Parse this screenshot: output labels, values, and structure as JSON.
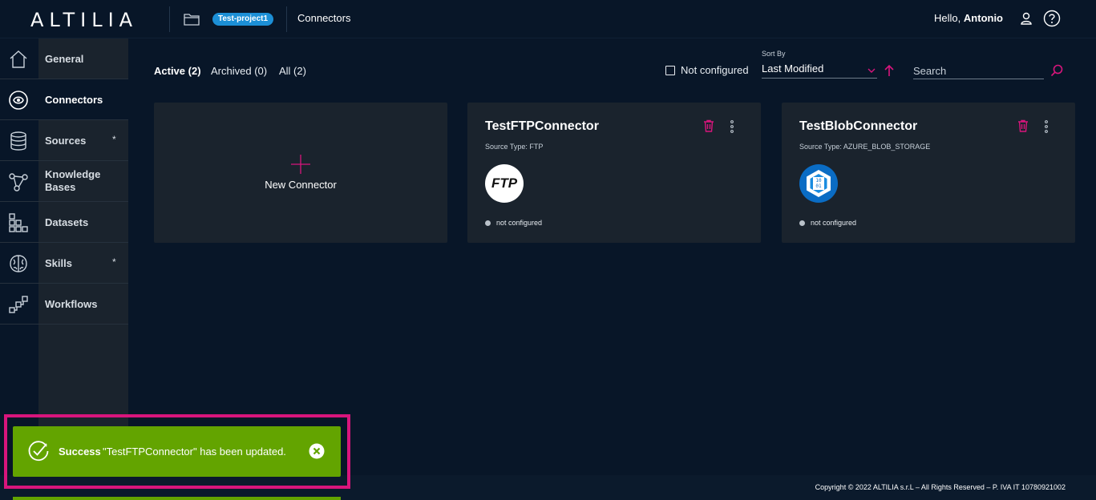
{
  "header": {
    "logo": "ALTILIA",
    "project": "Test-project1",
    "breadcrumb": "Connectors",
    "greeting": "Hello,",
    "user_name": "Antonio"
  },
  "sidebar": {
    "items": [
      {
        "label": "General",
        "icon": "home-icon",
        "active": false,
        "star": ""
      },
      {
        "label": "Connectors",
        "icon": "connector-icon",
        "active": true,
        "star": ""
      },
      {
        "label": "Sources",
        "icon": "database-icon",
        "active": false,
        "star": "*"
      },
      {
        "label": "Knowledge Bases",
        "icon": "graph-icon",
        "active": false,
        "star": ""
      },
      {
        "label": "Datasets",
        "icon": "dataset-icon",
        "active": false,
        "star": ""
      },
      {
        "label": "Skills",
        "icon": "brain-icon",
        "active": false,
        "star": "*"
      },
      {
        "label": "Workflows",
        "icon": "workflow-icon",
        "active": false,
        "star": ""
      }
    ]
  },
  "tabs": [
    {
      "label": "Active (2)",
      "active": true
    },
    {
      "label": "Archived (0)",
      "active": false
    },
    {
      "label": "All (2)",
      "active": false
    }
  ],
  "filters": {
    "not_configured_label": "Not configured",
    "not_configured_checked": false,
    "sort_caption": "Sort By",
    "sort_value": "Last Modified",
    "search_placeholder": "Search"
  },
  "new_connector_label": "New Connector",
  "connectors": [
    {
      "name": "TestFTPConnector",
      "source": "Source Type: FTP",
      "logo": "FTP",
      "status": "not configured"
    },
    {
      "name": "TestBlobConnector",
      "source": "Source Type: AZURE_BLOB_STORAGE",
      "logo": "10 01",
      "status": "not configured"
    }
  ],
  "toast": {
    "title": "Success",
    "message": "\"TestFTPConnector\" has been updated."
  },
  "footer": "Copyright © 2022 ALTILIA s.r.L – All Rights Reserved – P. IVA IT 10780921002",
  "colors": {
    "accent": "#d8157c",
    "success": "#63a400",
    "badge": "#1c8fd6",
    "background": "#081628",
    "card": "#1a232d"
  }
}
